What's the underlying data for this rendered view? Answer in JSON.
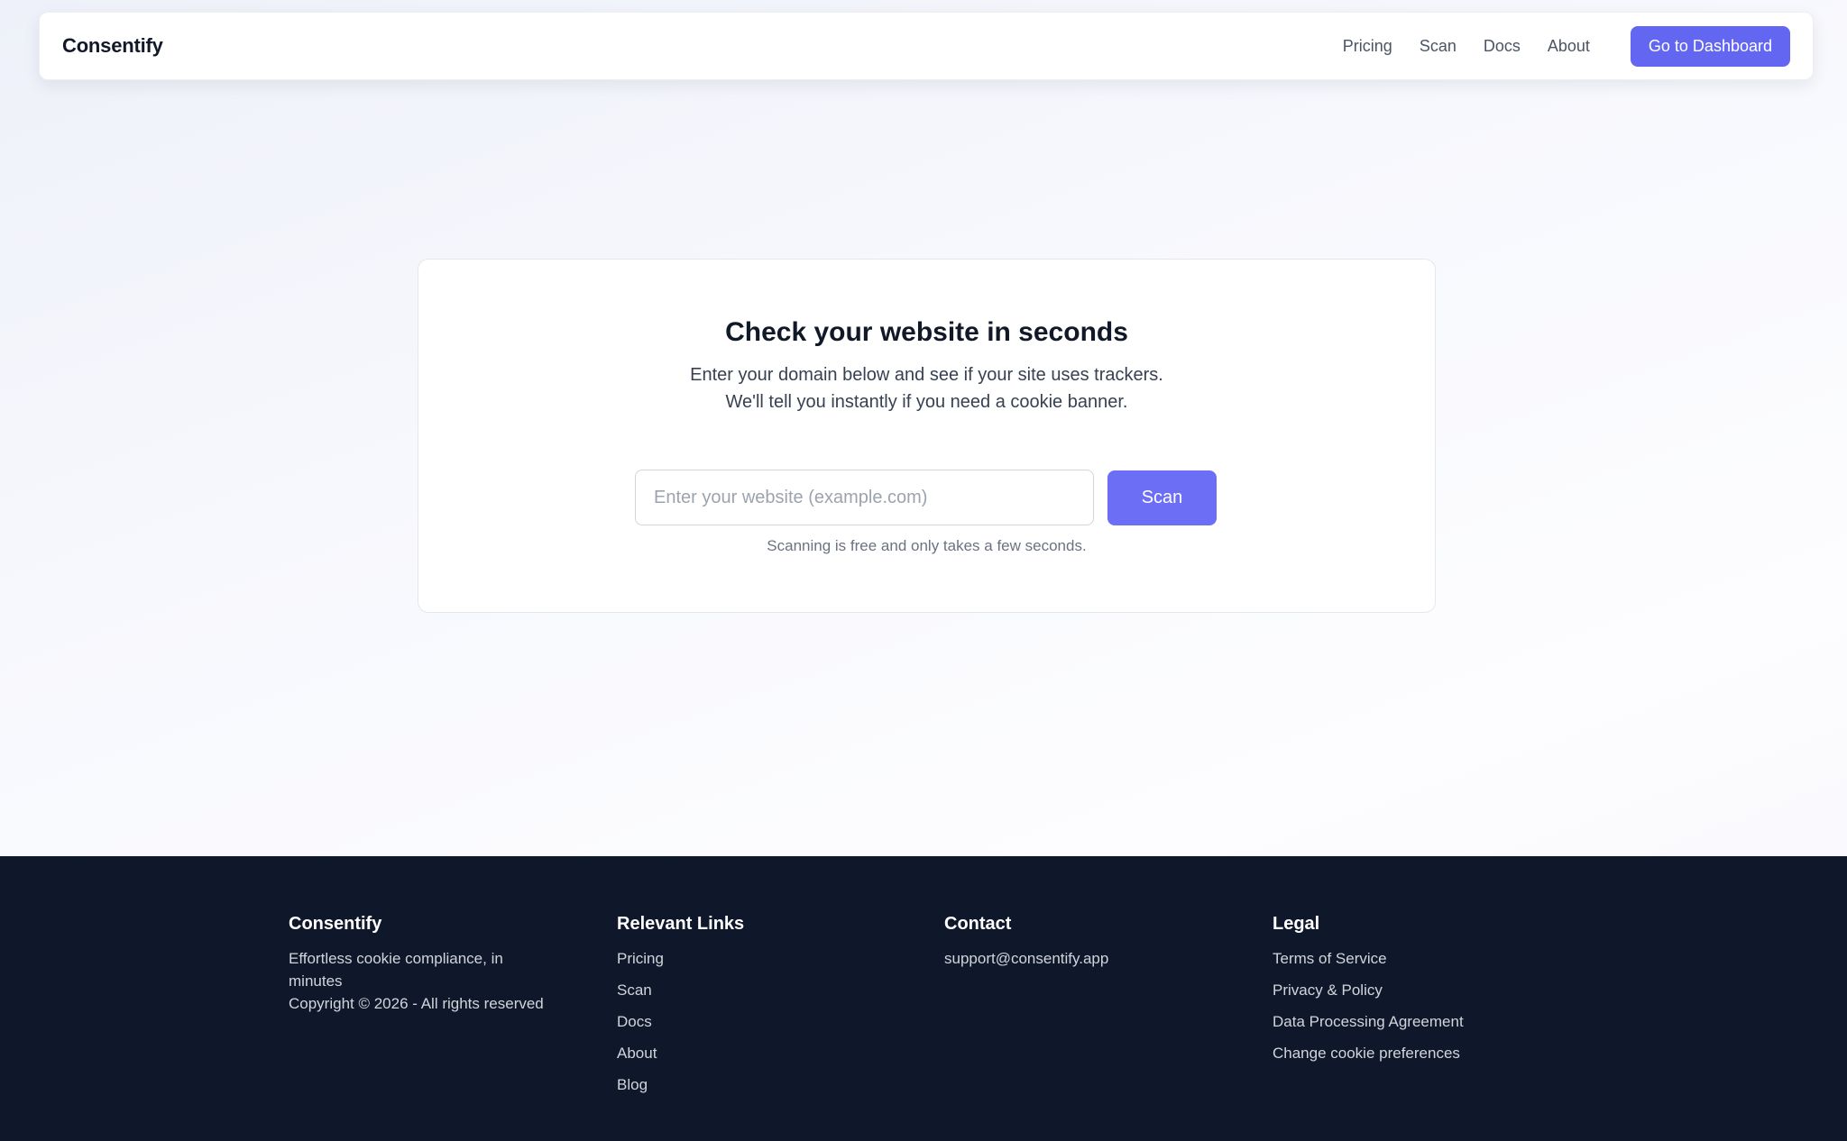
{
  "nav": {
    "brand": "Consentify",
    "links": [
      "Pricing",
      "Scan",
      "Docs",
      "About"
    ],
    "cta": "Go to Dashboard"
  },
  "hero": {
    "title": "Check your website in seconds",
    "subtitle_line1": "Enter your domain below and see if your site uses trackers.",
    "subtitle_line2": "We'll tell you instantly if you need a cookie banner.",
    "input_value": "",
    "input_placeholder": "Enter your website (example.com)",
    "scan_button": "Scan",
    "note": "Scanning is free and only takes a few seconds."
  },
  "footer": {
    "brand": {
      "heading": "Consentify",
      "tagline": "Effortless cookie compliance, in minutes",
      "copyright": "Copyright © 2026 - All rights reserved"
    },
    "links": {
      "heading": "Relevant Links",
      "items": [
        "Pricing",
        "Scan",
        "Docs",
        "About",
        "Blog"
      ]
    },
    "contact": {
      "heading": "Contact",
      "email": "support@consentify.app"
    },
    "legal": {
      "heading": "Legal",
      "items": [
        "Terms of Service",
        "Privacy & Policy",
        "Data Processing Agreement",
        "Change cookie preferences"
      ]
    }
  },
  "colors": {
    "accent": "#6366f1",
    "footer_bg": "#0f172a",
    "text_primary": "#111827",
    "text_muted": "#6b7280"
  }
}
